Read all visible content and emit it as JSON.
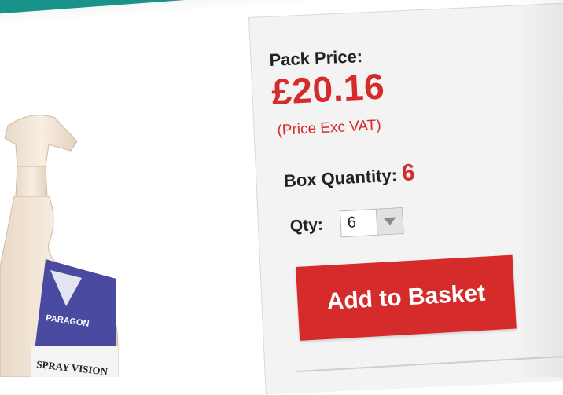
{
  "header": {
    "accent_color": "#17938a"
  },
  "product": {
    "image_icon": "spray-bottle-icon",
    "brand_text": "PARAGON",
    "name_text": "SPRAY VISION"
  },
  "purchase": {
    "pack_price_label": "Pack Price:",
    "price": "£20.16",
    "vat_note": "(Price Exc VAT)",
    "box_quantity_label": "Box Quantity:",
    "box_quantity_value": "6",
    "qty_label": "Qty:",
    "qty_value": "6",
    "add_button_label": "Add to Basket",
    "accent_color": "#d62b2b"
  }
}
